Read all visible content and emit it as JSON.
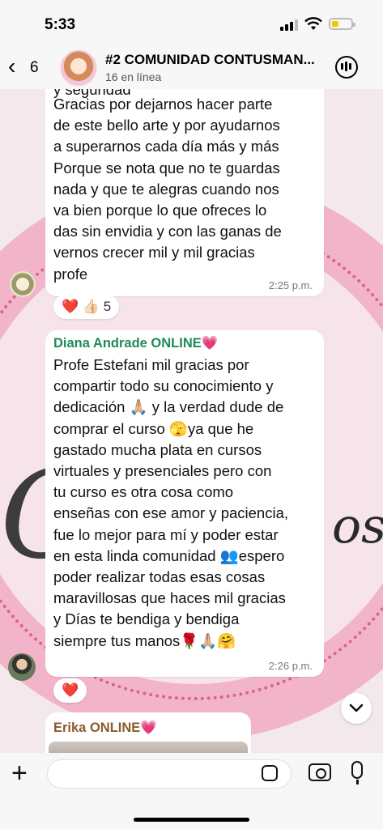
{
  "status_bar": {
    "time": "5:33"
  },
  "header": {
    "back_count": "6",
    "title": "#2 COMUNIDAD CONTUSMAN...",
    "subtitle": "16 en línea"
  },
  "messages": [
    {
      "partial_top": "y seguridad",
      "text": "Gracias por dejarnos hacer parte\nde este bello arte y por ayudarnos\na superarnos cada día más y más\nPorque se nota que no te guardas\nnada y que te alegras cuando nos\nva bien porque lo que ofreces lo\ndas sin envidia y con las ganas de\nvernos crecer mil y mil gracias\nprofe",
      "time": "2:25 p.m.",
      "reactions": "❤️ 👍🏻 5"
    },
    {
      "sender": "Diana Andrade ONLINE💗",
      "sender_color": "#1f8a5a",
      "text": "Profe Estefani mil gracias por\ncompartir todo su conocimiento y\ndedicación 🙏🏼 y la verdad dude de\ncomprar el curso 🫣ya que he\ngastado mucha plata en cursos\nvirtuales y presenciales pero con\ntu curso es otra cosa como\nenseñas con ese amor y paciencia,\nfue lo mejor para mí y  poder estar\nen esta linda comunidad 👥espero\npoder realizar todas esas cosas\nmaravillosas que haces mil gracias\ny Días te bendiga y bendiga\nsiempre tus manos🌹🙏🏼🤗",
      "time": "2:26 p.m.",
      "reactions": "❤️"
    },
    {
      "sender": "Erika ONLINE💗",
      "sender_color": "#8a5a2b"
    }
  ],
  "input": {
    "placeholder": ""
  },
  "colors": {
    "wallpaper_pink": "#f2b4c8",
    "dots": "#d9667f"
  }
}
